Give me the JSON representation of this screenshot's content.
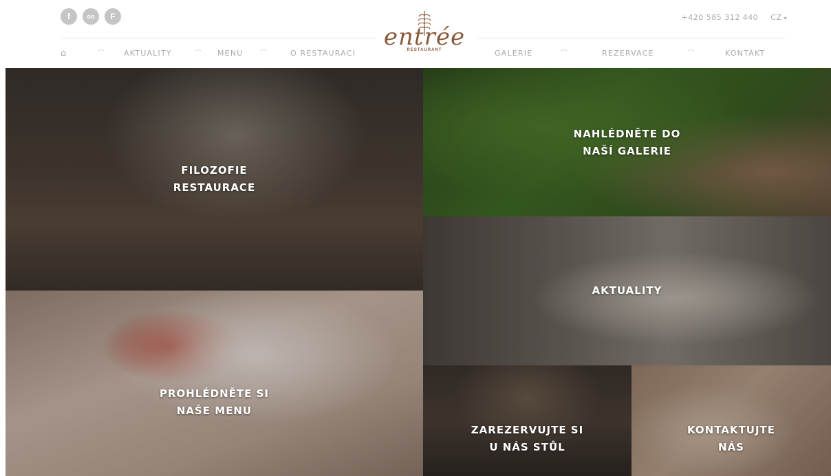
{
  "header": {
    "social": [
      {
        "icon": "facebook-icon",
        "glyph": "f"
      },
      {
        "icon": "tripadvisor-icon",
        "glyph": "oo"
      },
      {
        "icon": "foursquare-icon",
        "glyph": "F"
      }
    ],
    "phone": "+420 585 312 440",
    "language": "CZ",
    "logo": {
      "text": "entrée",
      "subtitle": "RESTAURANT"
    },
    "nav_left": [
      "AKTUALITY",
      "MENU",
      "O RESTAURACI"
    ],
    "nav_right": [
      "GALERIE",
      "REZERVACE",
      "KONTAKT"
    ],
    "home_icon": "home-icon"
  },
  "tiles": {
    "filozofie": {
      "line1": "FILOZOFIE",
      "line2": "RESTAURACE"
    },
    "galerie": {
      "line1": "NAHLÉDNĚTE DO",
      "line2": "NAŠÍ GALERIE"
    },
    "aktuality": {
      "line1": "AKTUALITY"
    },
    "menu": {
      "line1": "PROHLÉDNĚTE SI",
      "line2": "NAŠE MENU"
    },
    "rezervace": {
      "line1": "ZAREZERVUJTE SI",
      "line2": "U NÁS STŮL"
    },
    "kontakt": {
      "line1": "KONTAKTUJTE",
      "line2": "NÁS"
    }
  }
}
